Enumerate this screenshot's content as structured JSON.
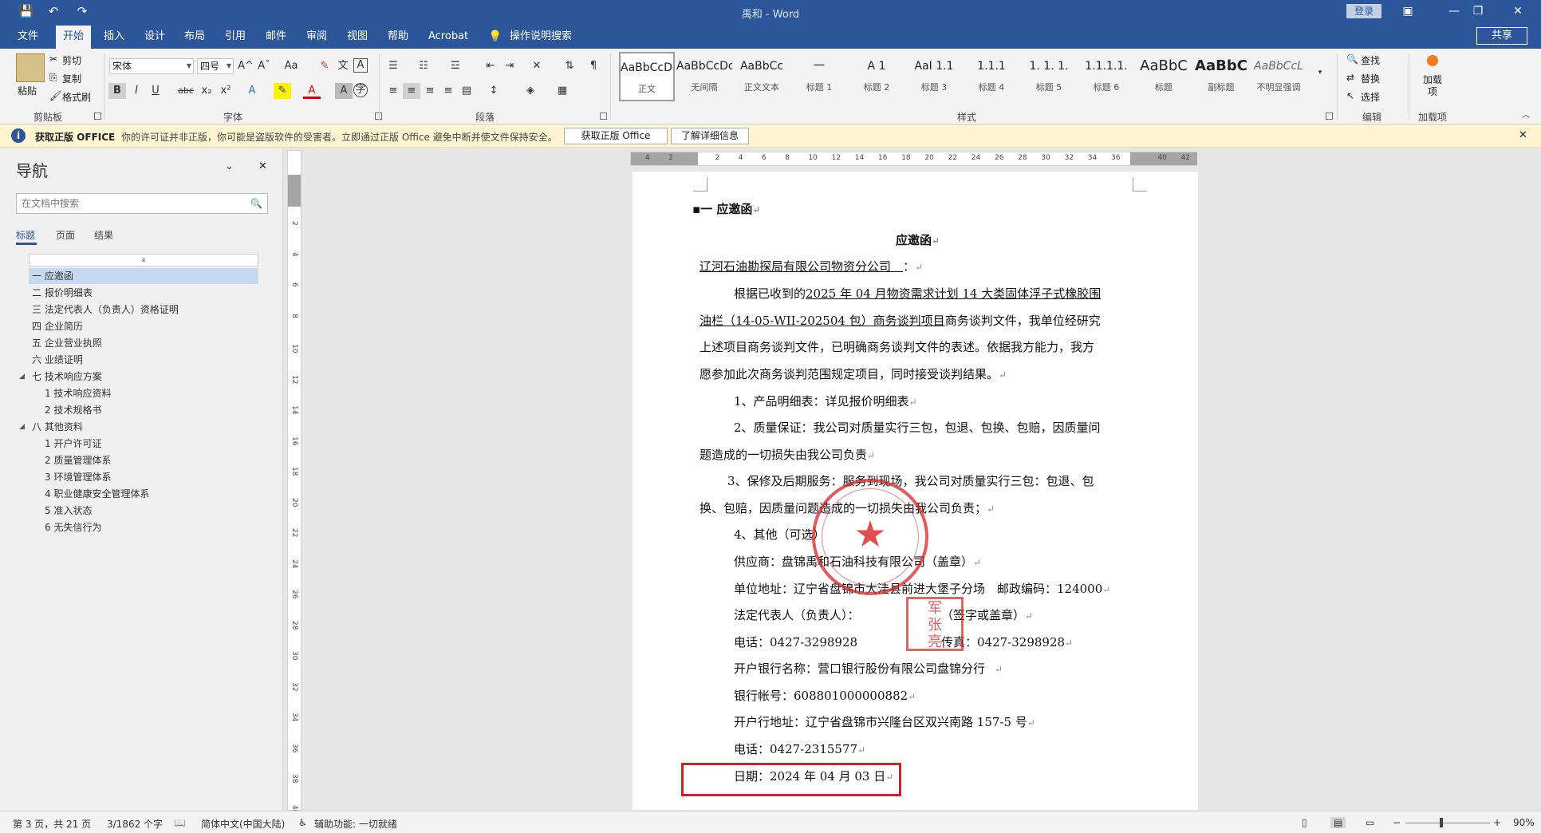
{
  "titlebar": {
    "title": "禹和 - Word",
    "login": "登录"
  },
  "quick_access": {
    "save": "💾",
    "undo": "↶",
    "redo": "↷"
  },
  "window": {
    "ribbon_opts": "▣",
    "minimize": "—",
    "restore": "❐",
    "close": "✕"
  },
  "tabs": [
    "文件",
    "开始",
    "插入",
    "设计",
    "布局",
    "引用",
    "邮件",
    "审阅",
    "视图",
    "帮助",
    "Acrobat",
    "操作说明搜索"
  ],
  "share": "共享",
  "ribbon": {
    "clipboard": {
      "paste": "粘贴",
      "cut": "剪切",
      "copy": "复制",
      "format_painter": "格式刷",
      "group": "剪贴板"
    },
    "font": {
      "name": "宋体",
      "size": "四号",
      "group": "字体",
      "bold": "B",
      "italic": "I",
      "underline": "U",
      "strike": "abc",
      "sub": "x₂",
      "sup": "x²",
      "grow": "A^",
      "shrink": "Aˇ",
      "case": "Aa",
      "clear": "A"
    },
    "paragraph": {
      "group": "段落"
    },
    "styles": {
      "group": "样式",
      "items": [
        {
          "preview": "AaBbCcDc",
          "name": "正文"
        },
        {
          "preview": "AaBbCcDc",
          "name": "无间隔"
        },
        {
          "preview": "AaBbCc",
          "name": "正文文本"
        },
        {
          "preview": "一",
          "name": "标题 1"
        },
        {
          "preview": "A 1",
          "name": "标题 2"
        },
        {
          "preview": "AaI 1.1",
          "name": "标题 3"
        },
        {
          "preview": "1.1.1",
          "name": "标题 4"
        },
        {
          "preview": "1. 1. 1.",
          "name": "标题 5"
        },
        {
          "preview": "1.1.1.1.",
          "name": "标题 6"
        },
        {
          "preview": "AaBbC",
          "name": "标题"
        },
        {
          "preview": "AaBbC",
          "name": "副标题"
        },
        {
          "preview": "AaBbCcL",
          "name": "不明显强调"
        }
      ]
    },
    "editing": {
      "find": "查找",
      "replace": "替换",
      "select": "选择",
      "group": "编辑"
    },
    "addins": {
      "label": "加载项",
      "button": "加载项"
    }
  },
  "message_bar": {
    "title": "获取正版 OFFICE",
    "text": "你的许可证并非正版，你可能是盗版软件的受害者。立即通过正版 Office 避免中断并使文件保持安全。",
    "btn1": "获取正版 Office",
    "btn2": "了解详细信息"
  },
  "nav": {
    "title": "导航",
    "search_placeholder": "在文档中搜索",
    "tabs": [
      "标题",
      "页面",
      "结果"
    ],
    "items": [
      "一 应邀函",
      "二 报价明细表",
      "三 法定代表人（负责人）资格证明",
      "四 企业简历",
      "五 企业营业执照",
      "六 业绩证明",
      "七 技术响应方案",
      "1 技术响应资料",
      "2 技术规格书",
      "八 其他资料",
      "1 开户许可证",
      "2 质量管理体系",
      "3 环境管理体系",
      "4 职业健康安全管理体系",
      "5 准入状态",
      "6 无失信行为"
    ]
  },
  "hruler_labels": [
    "4",
    "2",
    "",
    "2",
    "4",
    "6",
    "8",
    "10",
    "12",
    "14",
    "16",
    "18",
    "20",
    "22",
    "24",
    "26",
    "28",
    "30",
    "32",
    "34",
    "36",
    "",
    "40",
    "42"
  ],
  "vruler_labels": [
    "2",
    "4",
    "6",
    "8",
    "10",
    "12",
    "14",
    "16",
    "18",
    "20",
    "22",
    "24",
    "26",
    "28",
    "30",
    "32",
    "34",
    "36",
    "38",
    "40"
  ],
  "doc": {
    "heading": "一 应邀函",
    "title": "应邀函",
    "addressee": "辽河石油勘探局有限公司物资分公司",
    "addressee_colon": "：",
    "p1a": "根据已收到的",
    "p1b": "2025 年 04 月物资需求计划 14 大类固体浮子式橡胶围",
    "p2a": "油栏（14-05-WII-202504 包）商务谈判项目",
    "p2b": "商务谈判文件，我单位经研究",
    "p3": "上述项目商务谈判文件，已明确商务谈判文件的表述。依据我方能力，我方",
    "p4": "愿参加此次商务谈判范围规定项目，同时接受谈判结果。",
    "i1": "1、产品明细表：详见报价明细表",
    "i2a": "2、质量保证：我公司对质量实行三包，包退、包换、包赔，因质量问",
    "i2b": "题造成的一切损失由我公司负责",
    "i3a": "3、保修及后期服务：服务到现场，我公司对质量实行三包：包退、包",
    "i3b": "换、包赔，因质量问题造成的一切损失由我公司负责；",
    "i4": "4、其他（可选）",
    "supplier": "供应商：盘锦禹和石油科技有限公司（盖章）",
    "address": "单位地址：辽宁省盘锦市大洼县前进大堡子分场　邮政编码：124000",
    "legal": "法定代表人（负责人）：",
    "sign": "（签字或盖章）",
    "phone": "电话：0427-3298928",
    "fax": "传真：0427-3298928",
    "bank": "开户银行名称：营口银行股份有限公司盘锦分行",
    "account": "银行帐号：608801000000882",
    "bank_addr": "开户行地址：辽宁省盘锦市兴隆台区双兴南路 157-5 号",
    "phone2": "电话：0427-2315577",
    "date": "日期：2024 年 04 月 03 日",
    "seal_chars": "军\n张\n亮"
  },
  "status": {
    "page": "第 3 页，共 21 页",
    "words": "3/1862 个字",
    "lang": "简体中文(中国大陆)",
    "access": "辅助功能: 一切就绪",
    "zoom": "90%"
  },
  "colors": {
    "brand": "#2b579a",
    "stamp": "#d62424",
    "highlight_box": "#d1202a"
  }
}
